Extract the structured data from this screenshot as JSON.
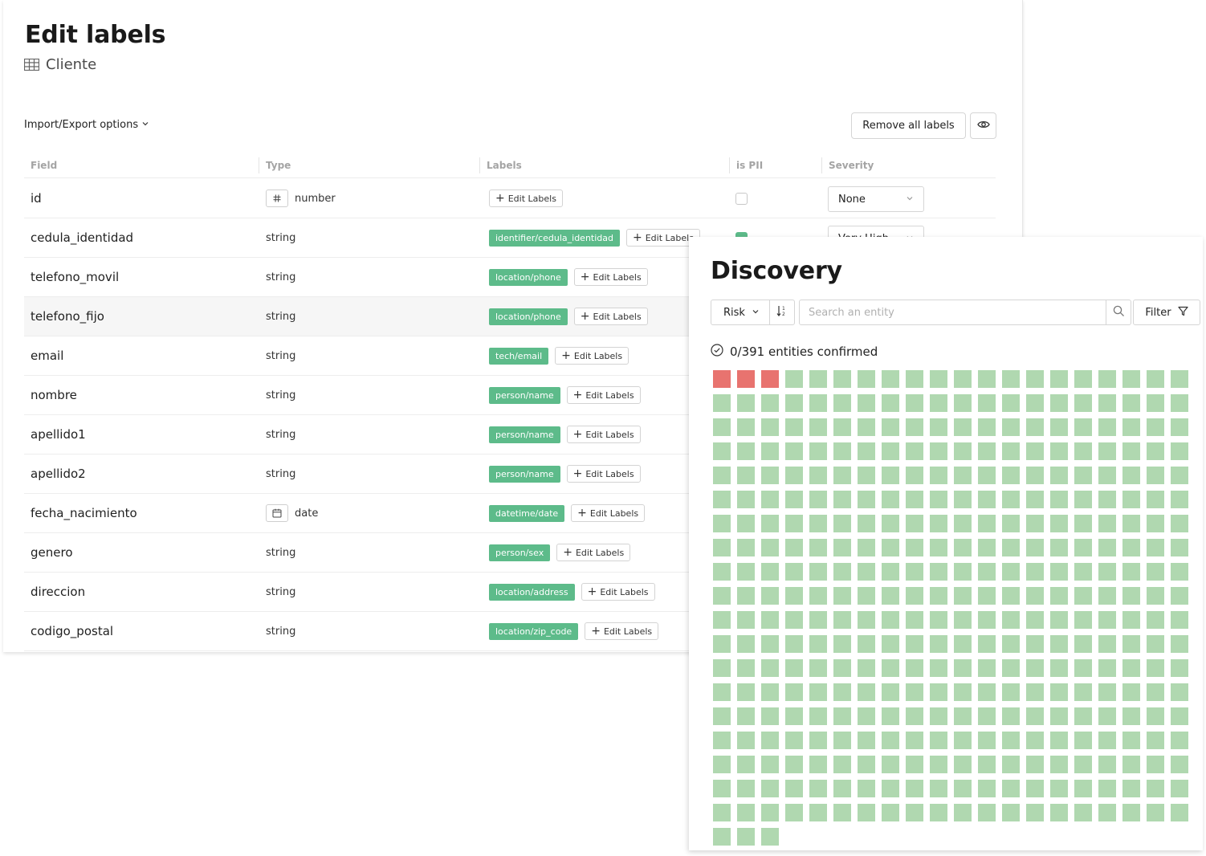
{
  "edit_labels": {
    "title": "Edit labels",
    "table_name": "Cliente",
    "import_export": "Import/Export options",
    "remove_all": "Remove all labels",
    "columns": {
      "field": "Field",
      "type": "Type",
      "labels": "Labels",
      "is_pii": "is PII",
      "severity": "Severity"
    },
    "edit_labels_text": "Edit Labels",
    "rows": [
      {
        "field": "id",
        "type": "number",
        "type_icon": "hash-icon",
        "labels": [],
        "pii": false,
        "severity": "None"
      },
      {
        "field": "cedula_identidad",
        "type": "string",
        "labels": [
          "identifier/cedula_identidad"
        ],
        "pii": true,
        "severity": "Very High"
      },
      {
        "field": "telefono_movil",
        "type": "string",
        "labels": [
          "location/phone"
        ]
      },
      {
        "field": "telefono_fijo",
        "type": "string",
        "labels": [
          "location/phone"
        ]
      },
      {
        "field": "email",
        "type": "string",
        "labels": [
          "tech/email"
        ]
      },
      {
        "field": "nombre",
        "type": "string",
        "labels": [
          "person/name"
        ]
      },
      {
        "field": "apellido1",
        "type": "string",
        "labels": [
          "person/name"
        ]
      },
      {
        "field": "apellido2",
        "type": "string",
        "labels": [
          "person/name"
        ]
      },
      {
        "field": "fecha_nacimiento",
        "type": "date",
        "type_icon": "calendar-icon",
        "labels": [
          "datetime/date"
        ]
      },
      {
        "field": "genero",
        "type": "string",
        "labels": [
          "person/sex"
        ]
      },
      {
        "field": "direccion",
        "type": "string",
        "labels": [
          "location/address"
        ]
      },
      {
        "field": "codigo_postal",
        "type": "string",
        "labels": [
          "location/zip_code"
        ]
      }
    ]
  },
  "discovery": {
    "title": "Discovery",
    "sort_select": "Risk",
    "search_placeholder": "Search an entity",
    "filter": "Filter",
    "confirmed_text": "0/391 entities confirmed",
    "entities_visible": 383,
    "high_risk_count": 3,
    "colors": {
      "high_risk": "#e8736f",
      "low_risk": "#b0d8b0",
      "label_tag": "#5dbb8a"
    }
  }
}
